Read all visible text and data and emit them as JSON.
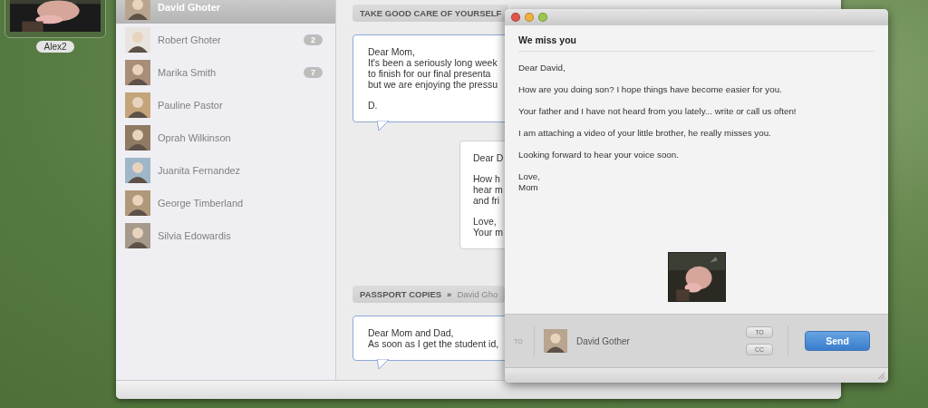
{
  "desktop_items": [
    {
      "label": "Alex2",
      "kind": "picture"
    }
  ],
  "contacts": [
    {
      "name": "David Ghoter",
      "selected": true
    },
    {
      "name": "Robert Ghoter",
      "selected": false,
      "badge": "2"
    },
    {
      "name": "Marika Smith",
      "selected": false,
      "badge": "7"
    },
    {
      "name": "Pauline Pastor",
      "selected": false
    },
    {
      "name": "Oprah Wilkinson",
      "selected": false
    },
    {
      "name": "Juanita Fernandez",
      "selected": false
    },
    {
      "name": "George Timberland",
      "selected": false
    },
    {
      "name": "Silvia Edowardis",
      "selected": false
    }
  ],
  "threads": [
    {
      "title": "TAKE GOOD CARE OF YOURSELF",
      "messages": [
        {
          "kind": "sent",
          "paragraphs": [
            "Dear Mom,\nIt's been a seriously long week\nto finish for our final presenta\nbut we are enjoying the pressu",
            "D."
          ]
        },
        {
          "kind": "received",
          "paragraphs": [
            "Dear D",
            "How h\nhear m\nand fri",
            "Love,\nYour m"
          ]
        }
      ]
    },
    {
      "title": "PASSPORT COPIES",
      "separator": "»",
      "participant": "David Gho",
      "messages": [
        {
          "kind": "sent",
          "paragraphs": [
            "Dear Mom and Dad,\nAs soon as I get the student id,"
          ]
        }
      ]
    }
  ],
  "compose": {
    "subject": "We miss you",
    "body": [
      "Dear David,",
      "How are you doing son? I hope things have become easier for you.",
      "Your father and I have not heard from you lately... write or call us often!",
      "I am attaching a video of your little brother, he really misses you.",
      "Looking forward to hear your voice soon.",
      "Love,\nMom"
    ],
    "attachment": {
      "kind": "picture"
    },
    "to_label": "TO",
    "recipient": "David Gother",
    "field_buttons": [
      "TO",
      "CC"
    ],
    "send_button": "Send"
  }
}
